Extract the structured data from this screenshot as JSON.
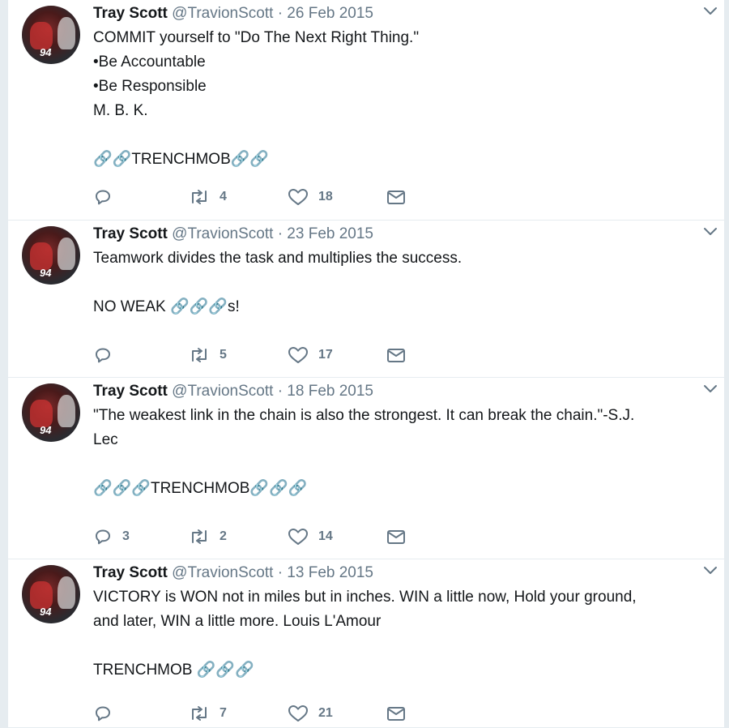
{
  "tweets": [
    {
      "name": "Tray Scott",
      "handle": "@TravionScott",
      "separator": "·",
      "date": "26 Feb 2015",
      "avatar_number": "94",
      "text": "COMMIT yourself to \"Do The Next Right Thing.\"\n•Be Accountable\n•Be Responsible\nM. B. K.\n\n🔗🔗TRENCHMOB🔗🔗",
      "replies": "",
      "retweets": "4",
      "likes": "18"
    },
    {
      "name": "Tray Scott",
      "handle": "@TravionScott",
      "separator": "·",
      "date": "23 Feb 2015",
      "avatar_number": "94",
      "text": "Teamwork divides the task and multiplies the success.\n\nNO WEAK 🔗🔗🔗s!",
      "replies": "",
      "retweets": "5",
      "likes": "17"
    },
    {
      "name": "Tray Scott",
      "handle": "@TravionScott",
      "separator": "·",
      "date": "18 Feb 2015",
      "avatar_number": "94",
      "text": "\"The weakest link in the chain is also the strongest. It can break the chain.\"-S.J.\nLec\n\n🔗🔗🔗TRENCHMOB🔗🔗🔗",
      "replies": "3",
      "retweets": "2",
      "likes": "14"
    },
    {
      "name": "Tray Scott",
      "handle": "@TravionScott",
      "separator": "·",
      "date": "13 Feb 2015",
      "avatar_number": "94",
      "text": "VICTORY is WON not in miles but in inches. WIN a little now, Hold your ground,\nand later, WIN a little more. Louis L'Amour\n\nTRENCHMOB 🔗🔗🔗",
      "replies": "",
      "retweets": "7",
      "likes": "21"
    }
  ],
  "icons": {
    "reply": "reply-icon",
    "retweet": "retweet-icon",
    "like": "heart-icon",
    "message": "envelope-icon",
    "menu": "chevron-down-icon"
  },
  "colors": {
    "muted": "#657786",
    "text": "#14171a",
    "divider": "#e6ecf0"
  }
}
